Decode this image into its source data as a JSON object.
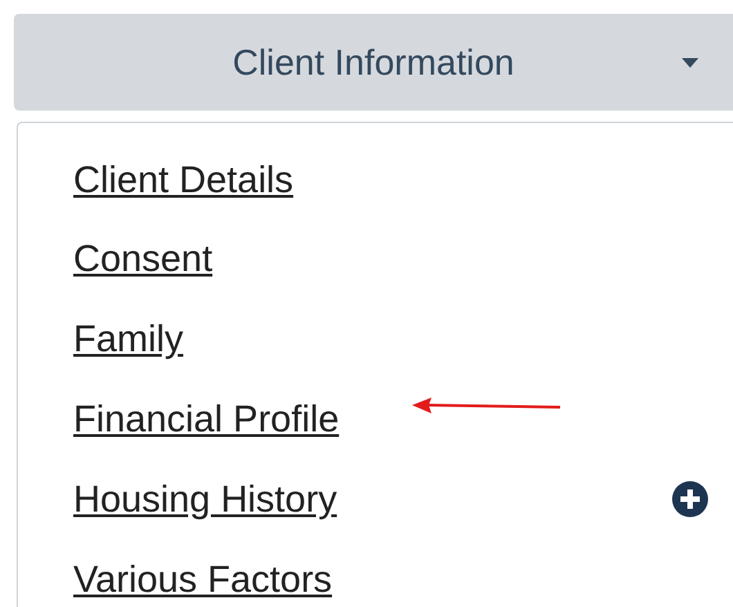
{
  "dropdown": {
    "label": "Client Information",
    "expanded": true
  },
  "menu_items": [
    {
      "label": "Client Details"
    },
    {
      "label": "Consent"
    },
    {
      "label": "Family"
    },
    {
      "label": "Financial Profile"
    },
    {
      "label": "Housing History"
    },
    {
      "label": "Various Factors"
    }
  ]
}
